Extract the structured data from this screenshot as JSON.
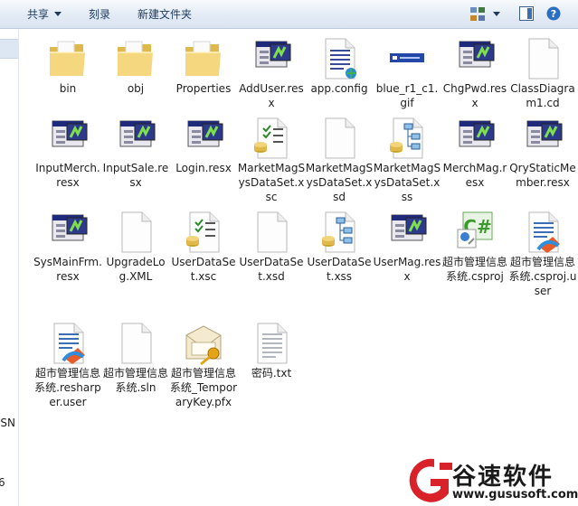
{
  "toolbar": {
    "share_label": "共享",
    "burn_label": "刻录",
    "new_folder_label": "新建文件夹"
  },
  "navpane": {
    "labels": [
      "MSN",
      "6"
    ]
  },
  "files": [
    {
      "name": "bin",
      "icon": "folder-icon"
    },
    {
      "name": "obj",
      "icon": "folder-icon"
    },
    {
      "name": "Properties",
      "icon": "folder-icon"
    },
    {
      "name": "AddUser.resx",
      "icon": "resx-icon"
    },
    {
      "name": "app.config",
      "icon": "config-icon"
    },
    {
      "name": "blue_r1_c1.gif",
      "icon": "gif-icon"
    },
    {
      "name": "ChgPwd.resx",
      "icon": "resx-icon"
    },
    {
      "name": "ClassDiagram1.cd",
      "icon": "blank-file-icon"
    },
    {
      "name": "InputMerch.resx",
      "icon": "resx-icon"
    },
    {
      "name": "InputSale.resx",
      "icon": "resx-icon"
    },
    {
      "name": "Login.resx",
      "icon": "resx-icon"
    },
    {
      "name": "MarketMagSysDataSet.xsc",
      "icon": "xsc-icon"
    },
    {
      "name": "MarketMagSysDataSet.xsd",
      "icon": "blank-file-icon"
    },
    {
      "name": "MarketMagSysDataSet.xss",
      "icon": "xss-icon"
    },
    {
      "name": "MerchMag.resx",
      "icon": "resx-icon"
    },
    {
      "name": "QryStaticMember.resx",
      "icon": "resx-icon"
    },
    {
      "name": "SysMainFrm.resx",
      "icon": "resx-icon"
    },
    {
      "name": "UpgradeLog.XML",
      "icon": "blank-file-icon"
    },
    {
      "name": "UserDataSet.xsc",
      "icon": "xsc-icon"
    },
    {
      "name": "UserDataSet.xsd",
      "icon": "blank-file-icon"
    },
    {
      "name": "UserDataSet.xss",
      "icon": "xss-icon"
    },
    {
      "name": "UserMag.resx",
      "icon": "resx-icon"
    },
    {
      "name": "超市管理信息系统.csproj",
      "icon": "csproj-icon"
    },
    {
      "name": "超市管理信息系统.csproj.user",
      "icon": "vs-user-icon"
    },
    {
      "name": "超市管理信息系统.resharper.user",
      "icon": "vs-user-icon"
    },
    {
      "name": "超市管理信息系统.sln",
      "icon": "blank-file-icon"
    },
    {
      "name": "超市管理信息系统_TemporaryKey.pfx",
      "icon": "pfx-icon"
    },
    {
      "name": "密码.txt",
      "icon": "txt-icon"
    }
  ],
  "watermark": {
    "brand": "谷速软件",
    "url": "www.gususoft.com",
    "color": "#d9212a"
  },
  "colors": {
    "folder": "#f2d47a",
    "toolbar_text": "#1e3a5f"
  }
}
